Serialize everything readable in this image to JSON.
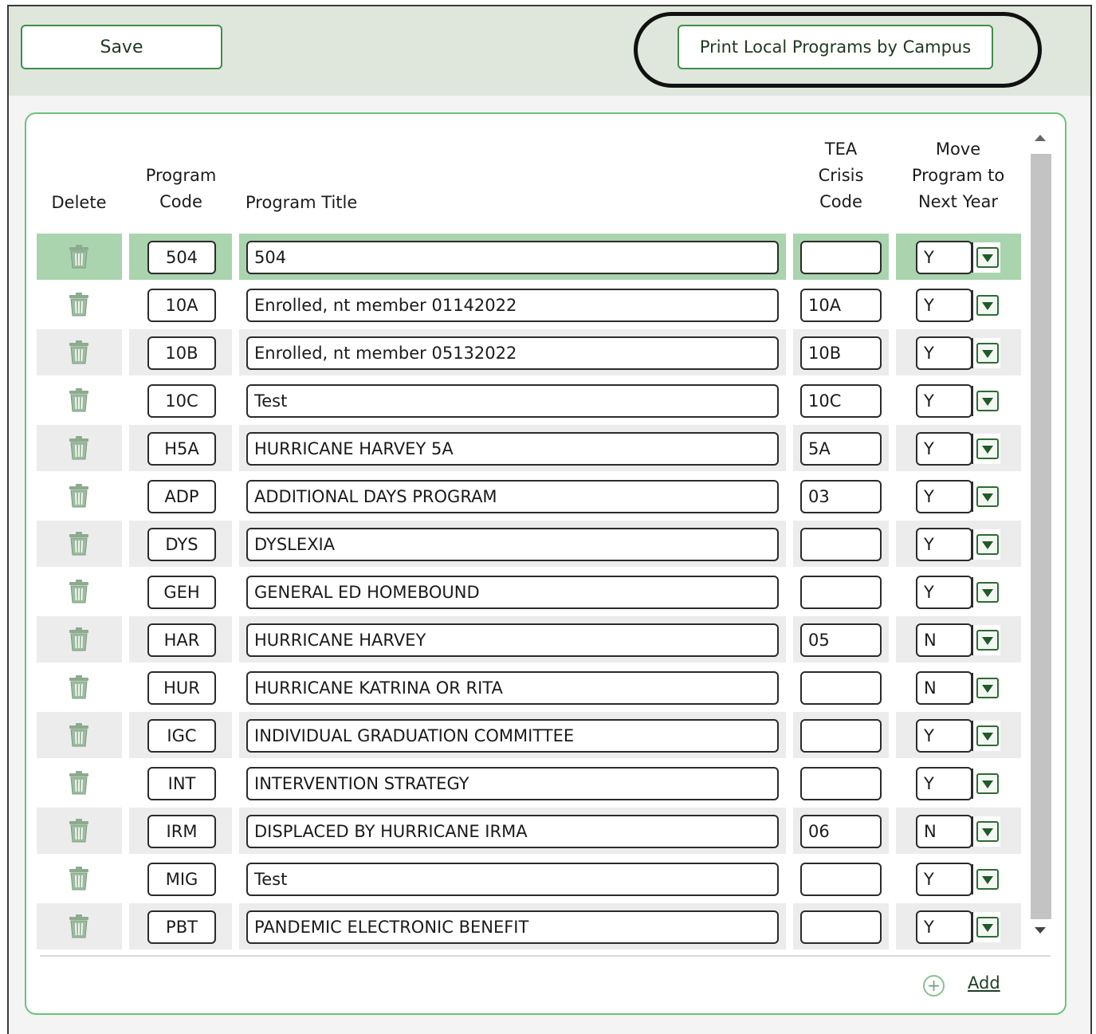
{
  "toolbar": {
    "save_label": "Save",
    "print_label": "Print Local Programs by Campus"
  },
  "table": {
    "headers": {
      "delete": "Delete",
      "code_line1": "Program",
      "code_line2": "Code",
      "title": "Program Title",
      "crisis_line1": "TEA",
      "crisis_line2": "Crisis",
      "crisis_line3": "Code",
      "move_line1": "Move",
      "move_line2": "Program to",
      "move_line3": "Next Year"
    },
    "rows": [
      {
        "code": "504",
        "title": "504",
        "crisis": "",
        "move": "Y"
      },
      {
        "code": "10A",
        "title": "Enrolled, nt member 01142022",
        "crisis": "10A",
        "move": "Y"
      },
      {
        "code": "10B",
        "title": "Enrolled, nt member 05132022",
        "crisis": "10B",
        "move": "Y"
      },
      {
        "code": "10C",
        "title": "Test",
        "crisis": "10C",
        "move": "Y"
      },
      {
        "code": "H5A",
        "title": "HURRICANE HARVEY 5A",
        "crisis": "5A",
        "move": "Y"
      },
      {
        "code": "ADP",
        "title": "ADDITIONAL DAYS PROGRAM",
        "crisis": "03",
        "move": "Y"
      },
      {
        "code": "DYS",
        "title": "DYSLEXIA",
        "crisis": "",
        "move": "Y"
      },
      {
        "code": "GEH",
        "title": "GENERAL ED HOMEBOUND",
        "crisis": "",
        "move": "Y"
      },
      {
        "code": "HAR",
        "title": "HURRICANE HARVEY",
        "crisis": "05",
        "move": "N"
      },
      {
        "code": "HUR",
        "title": "HURRICANE KATRINA OR RITA",
        "crisis": "",
        "move": "N"
      },
      {
        "code": "IGC",
        "title": "INDIVIDUAL GRADUATION COMMITTEE",
        "crisis": "",
        "move": "Y"
      },
      {
        "code": "INT",
        "title": "INTERVENTION STRATEGY",
        "crisis": "",
        "move": "Y"
      },
      {
        "code": "IRM",
        "title": "DISPLACED BY HURRICANE IRMA",
        "crisis": "06",
        "move": "N"
      },
      {
        "code": "MIG",
        "title": "Test",
        "crisis": "",
        "move": "Y"
      },
      {
        "code": "PBT",
        "title": "PANDEMIC ELECTRONIC BENEFIT",
        "crisis": "",
        "move": "Y"
      }
    ]
  },
  "footer": {
    "add_label": "Add"
  },
  "icons": {
    "delete": "trash-icon",
    "dropdown": "chevron-down-icon",
    "add": "plus-circle-icon"
  },
  "colors": {
    "accent": "#3e8e4a",
    "selected_row": "#a9d4ae",
    "toolbar_bg": "#dfe6dc"
  }
}
